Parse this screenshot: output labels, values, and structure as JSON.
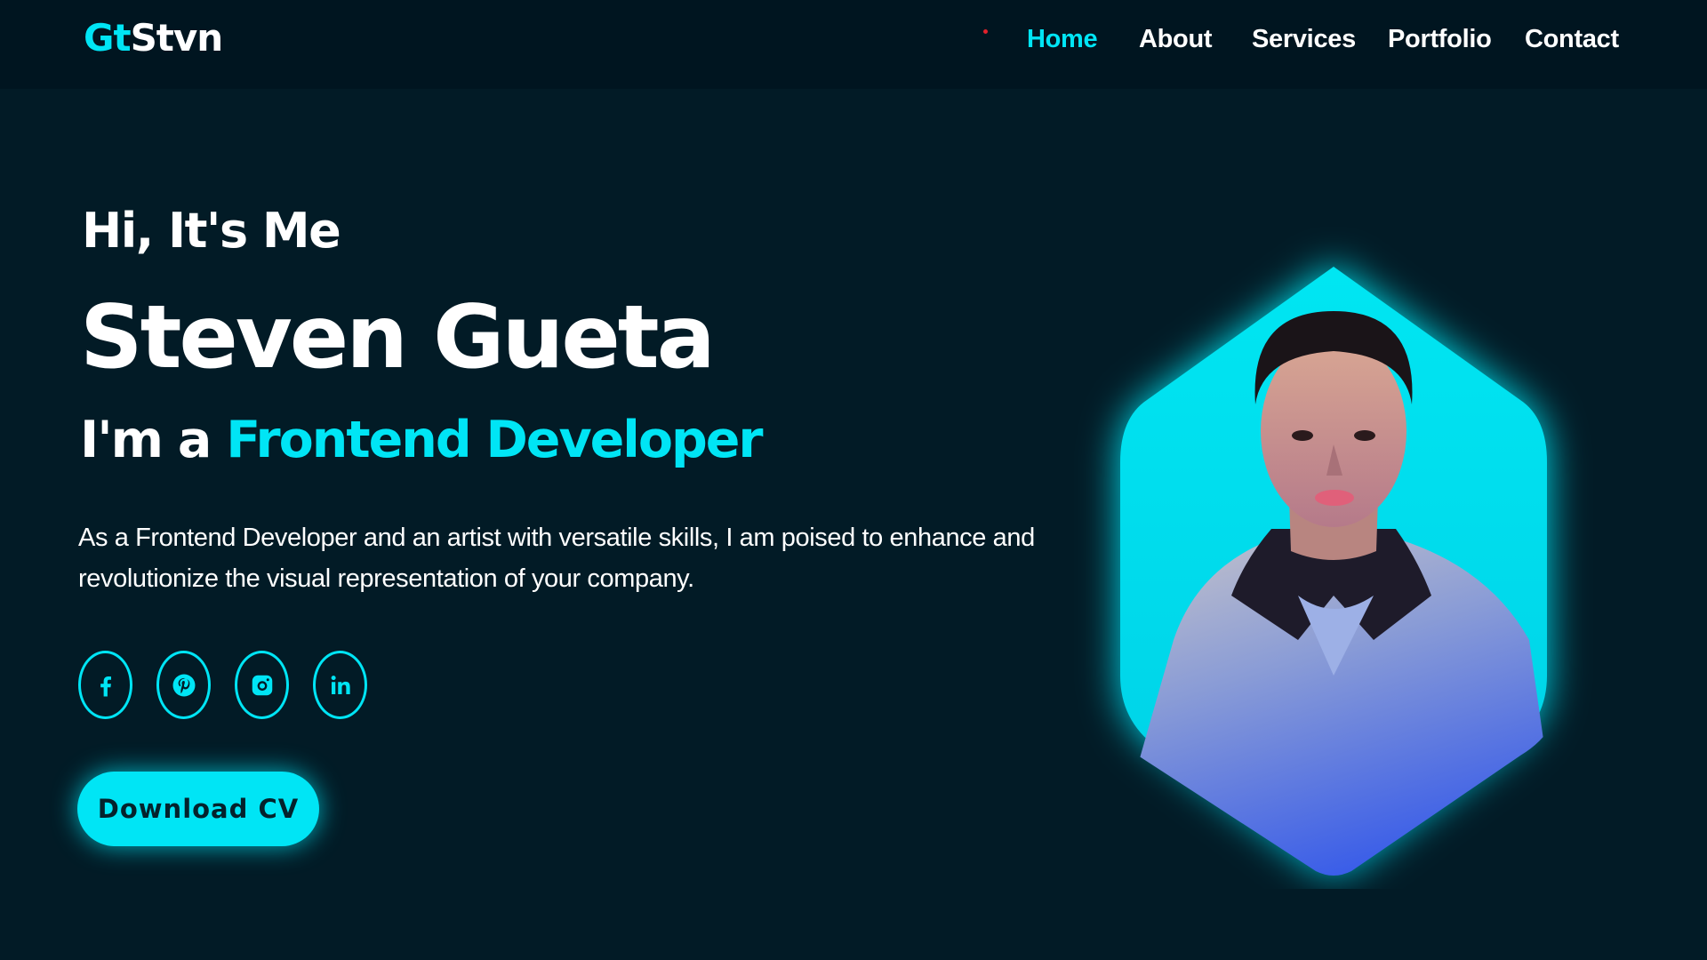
{
  "header": {
    "logo_accent": "Gt",
    "logo_rest": "Stvn",
    "nav": [
      {
        "label": "Home",
        "active": true
      },
      {
        "label": "About",
        "active": false
      },
      {
        "label": "Services",
        "active": false
      },
      {
        "label": "Portfolio",
        "active": false
      },
      {
        "label": "Contact",
        "active": false
      }
    ]
  },
  "hero": {
    "greeting": "Hi, It's Me",
    "name": "Steven Gueta",
    "role_prefix": "I'm a ",
    "role_highlight": "Frontend Developer",
    "description": "As a Frontend Developer and an artist with versatile skills, I am poised to enhance and revolutionize the visual representation of your company.",
    "socials": [
      {
        "icon": "facebook-icon"
      },
      {
        "icon": "pinterest-icon"
      },
      {
        "icon": "instagram-icon"
      },
      {
        "icon": "linkedin-icon"
      }
    ],
    "cta_label": "Download CV"
  },
  "colors": {
    "accent": "#00e5f5",
    "background": "#021b26",
    "navbar": "#001520"
  }
}
